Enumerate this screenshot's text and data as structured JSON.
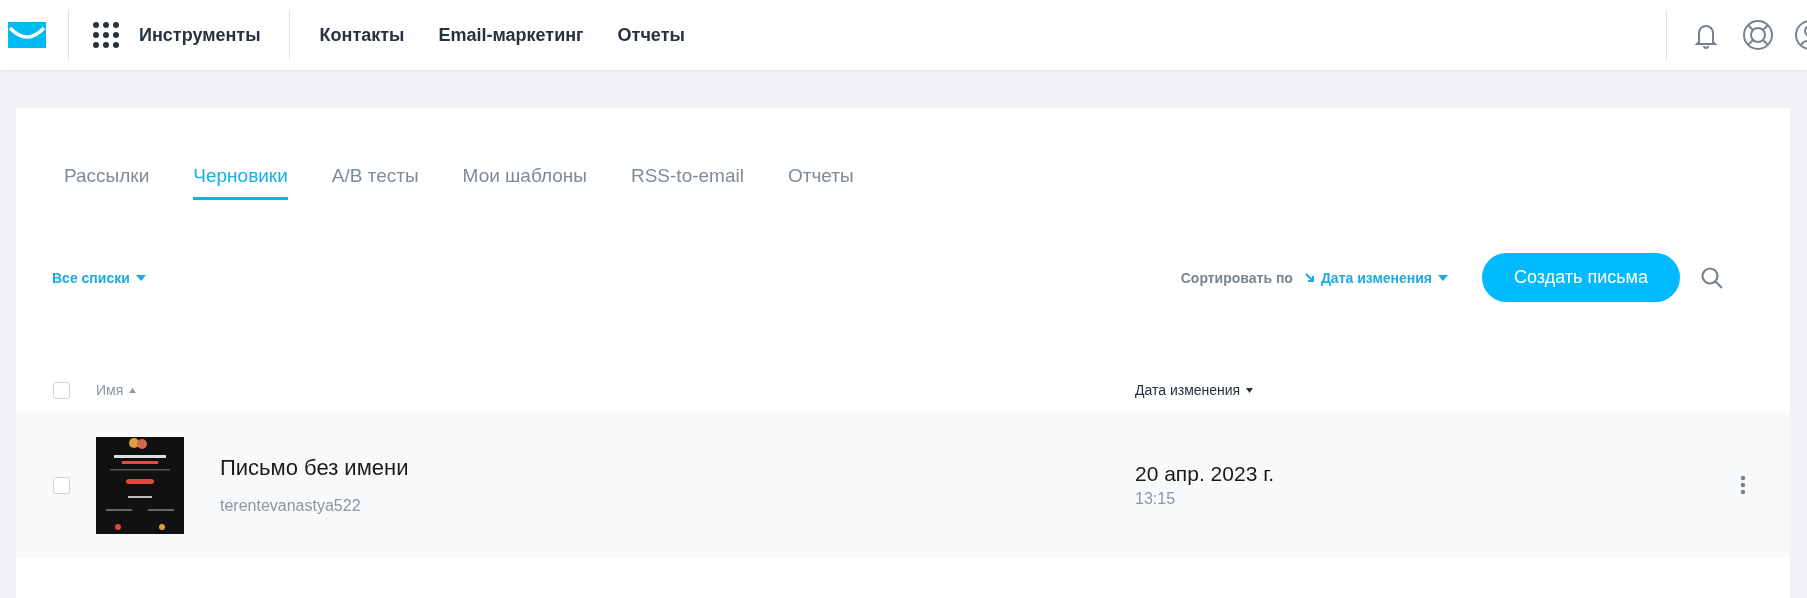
{
  "header": {
    "tools_label": "Инструменты",
    "nav": [
      "Контакты",
      "Email-маркетинг",
      "Отчеты"
    ]
  },
  "tabs": [
    {
      "label": "Рассылки",
      "selected": false
    },
    {
      "label": "Черновики",
      "selected": true
    },
    {
      "label": "A/B тесты",
      "selected": false
    },
    {
      "label": "Мои шаблоны",
      "selected": false
    },
    {
      "label": "RSS-to-email",
      "selected": false
    },
    {
      "label": "Отчеты",
      "selected": false
    }
  ],
  "filters": {
    "list_filter": "Все списки",
    "sort_label": "Сортировать по",
    "sort_value": "Дата изменения"
  },
  "create_button": "Создать письма",
  "table": {
    "all_checked": false,
    "columns": [
      {
        "label": "Имя",
        "sort_ascending": true
      },
      {
        "label": "Дата изменения",
        "sort_ascending": false
      }
    ],
    "rows": [
      {
        "checked": false,
        "title": "Письмо без имени",
        "author": "terentevanastya522",
        "date": "20 апр. 2023 г.",
        "time": "13:15"
      }
    ]
  }
}
